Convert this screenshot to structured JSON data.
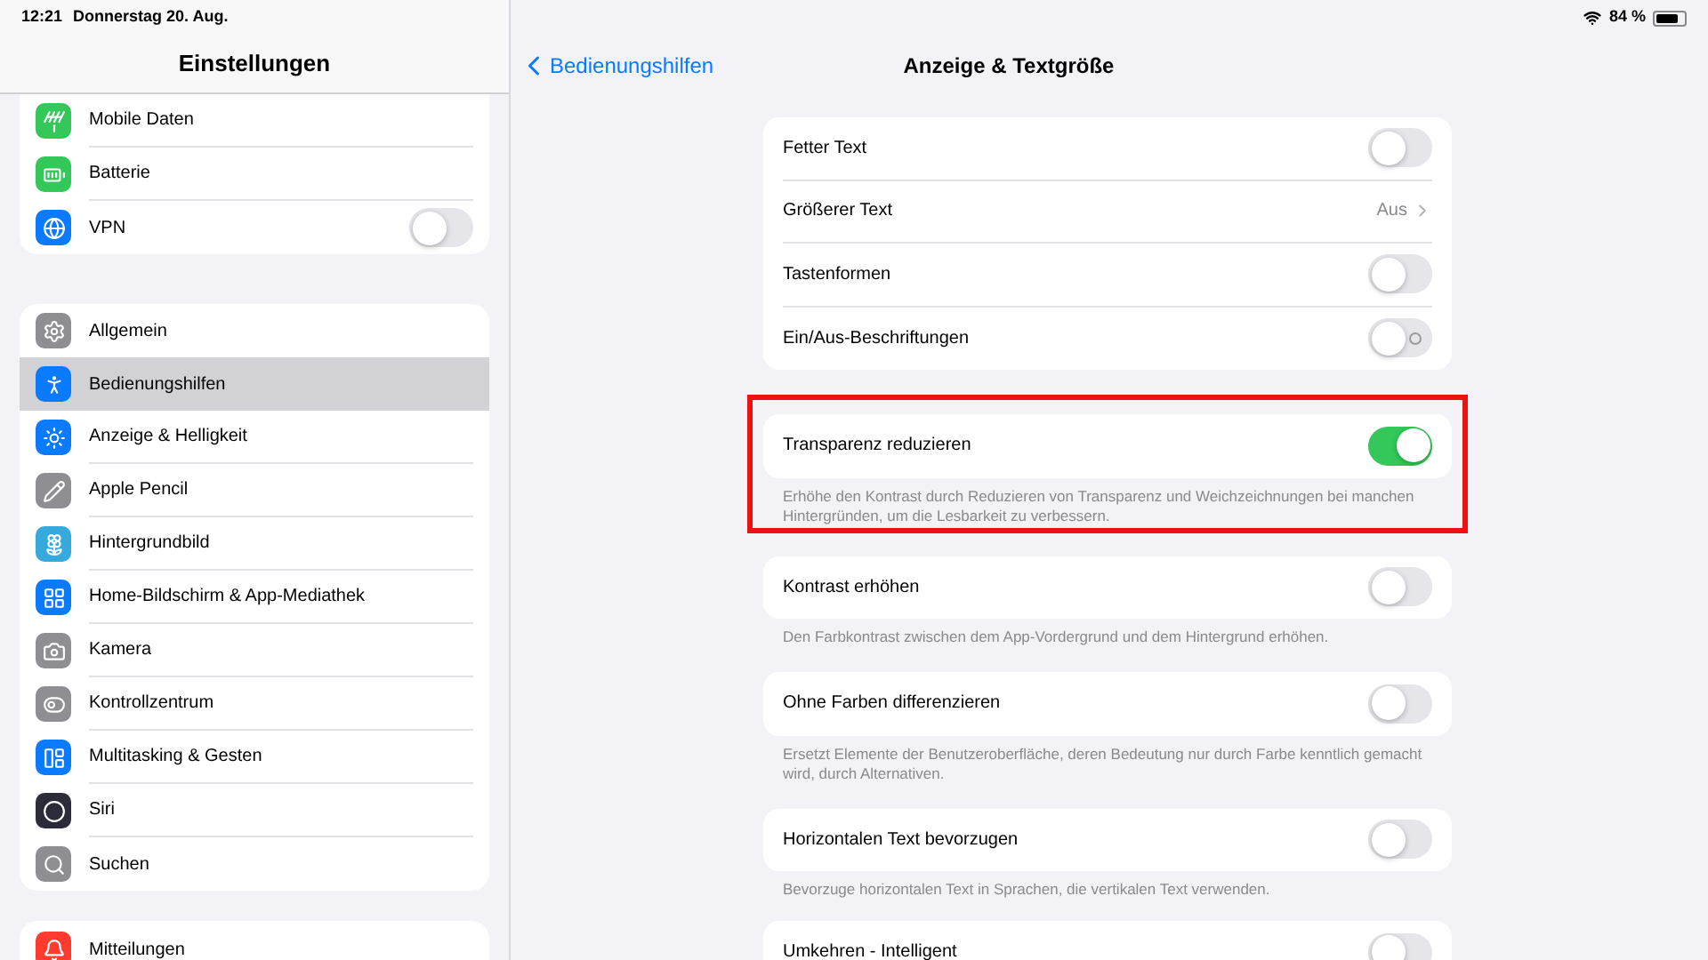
{
  "status_bar": {
    "time": "12:21",
    "date": "Donnerstag 20. Aug.",
    "battery": "84 %"
  },
  "sidebar": {
    "title": "Einstellungen",
    "groups": [
      {
        "items": [
          {
            "label": "Mobile Daten",
            "color": "#34c759",
            "selected": false
          },
          {
            "label": "Batterie",
            "color": "#34c759",
            "selected": false
          },
          {
            "label": "VPN",
            "color": "#0a7aff",
            "selected": false,
            "toggle": {
              "on": false
            }
          }
        ]
      },
      {
        "items": [
          {
            "label": "Allgemein",
            "color": "#8e8e93",
            "selected": false
          },
          {
            "label": "Bedienungshilfen",
            "color": "#0a7aff",
            "selected": true
          },
          {
            "label": "Anzeige & Helligkeit",
            "color": "#0a7aff",
            "selected": false
          },
          {
            "label": "Apple Pencil",
            "color": "#8e8e93",
            "selected": false
          },
          {
            "label": "Hintergrundbild",
            "color": "#36aadc",
            "selected": false
          },
          {
            "label": "Home-Bildschirm & App-Mediathek",
            "color": "#0a7aff",
            "selected": false
          },
          {
            "label": "Kamera",
            "color": "#8e8e93",
            "selected": false
          },
          {
            "label": "Kontrollzentrum",
            "color": "#8e8e93",
            "selected": false
          },
          {
            "label": "Multitasking & Gesten",
            "color": "#0a7aff",
            "selected": false
          },
          {
            "label": "Siri",
            "color": "#2b2b3a",
            "selected": false
          },
          {
            "label": "Suchen",
            "color": "#8e8e93",
            "selected": false
          }
        ]
      },
      {
        "items": [
          {
            "label": "Mitteilungen",
            "color": "#ff3b30",
            "selected": false
          }
        ]
      }
    ]
  },
  "detail": {
    "back": "Bedienungshilfen",
    "title": "Anzeige & Textgröße",
    "groups": [
      {
        "highlighted": false,
        "rows": [
          {
            "label": "Fetter Text",
            "kind": "toggle",
            "on": false
          },
          {
            "label": "Größerer Text",
            "kind": "value",
            "value": "Aus"
          },
          {
            "label": "Tastenformen",
            "kind": "toggle",
            "on": false
          },
          {
            "label": "Ein/Aus-Beschriftungen",
            "kind": "toggle",
            "on": false
          }
        ]
      },
      {
        "highlighted": true,
        "rows": [
          {
            "label": "Transparenz reduzieren",
            "kind": "toggle",
            "on": true
          }
        ],
        "footer": "Erhöhe den Kontrast durch Reduzieren von Transparenz und Weichzeichnungen bei manchen Hintergründen, um die Lesbarkeit zu verbessern."
      },
      {
        "highlighted": false,
        "rows": [
          {
            "label": "Kontrast erhöhen",
            "kind": "toggle",
            "on": false
          }
        ],
        "footer": "Den Farbkontrast zwischen dem App-Vordergrund und dem Hintergrund erhöhen."
      },
      {
        "highlighted": false,
        "rows": [
          {
            "label": "Ohne Farben differenzieren",
            "kind": "toggle",
            "on": false
          }
        ],
        "footer": "Ersetzt Elemente der Benutzeroberfläche, deren Bedeutung nur durch Farbe kenntlich gemacht wird, durch Alternativen."
      },
      {
        "highlighted": false,
        "rows": [
          {
            "label": "Horizontalen Text bevorzugen",
            "kind": "toggle",
            "on": false
          }
        ],
        "footer": "Bevorzuge horizontalen Text in Sprachen, die vertikalen Text verwenden."
      },
      {
        "highlighted": false,
        "rows": [
          {
            "label": "Umkehren - Intelligent",
            "kind": "toggle",
            "on": false
          }
        ]
      }
    ]
  }
}
